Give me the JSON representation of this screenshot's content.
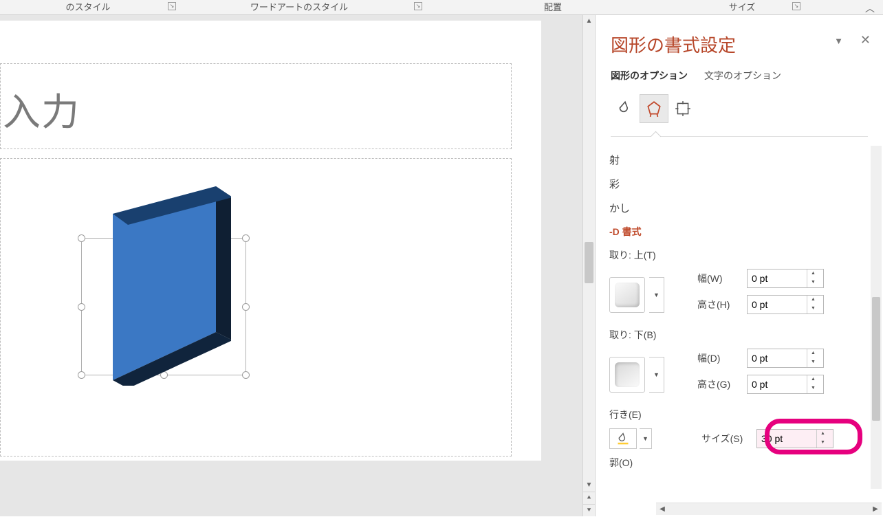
{
  "ribbon": {
    "group1": "のスタイル",
    "group2": "ワードアートのスタイル",
    "group3": "配置",
    "group4": "サイズ"
  },
  "slide": {
    "title_placeholder": "入力"
  },
  "pane": {
    "title": "図形の書式設定",
    "tab_shape": "図形のオプション",
    "tab_text": "文字のオプション",
    "sections": {
      "s1": "射",
      "s2": "彩",
      "s3": "かし",
      "s4": "-D 書式"
    },
    "bevel_top_label": "取り: 上(T)",
    "bevel_bottom_label": "取り: 下(B)",
    "width_w": "幅(W)",
    "height_h": "高さ(H)",
    "width_d": "幅(D)",
    "height_g": "高さ(G)",
    "depth_label": "行き(E)",
    "size_label": "サイズ(S)",
    "contour_label": "郭(O)",
    "val_width_w": "0 pt",
    "val_height_h": "0 pt",
    "val_width_d": "0 pt",
    "val_height_g": "0 pt",
    "val_size": "30 pt"
  }
}
